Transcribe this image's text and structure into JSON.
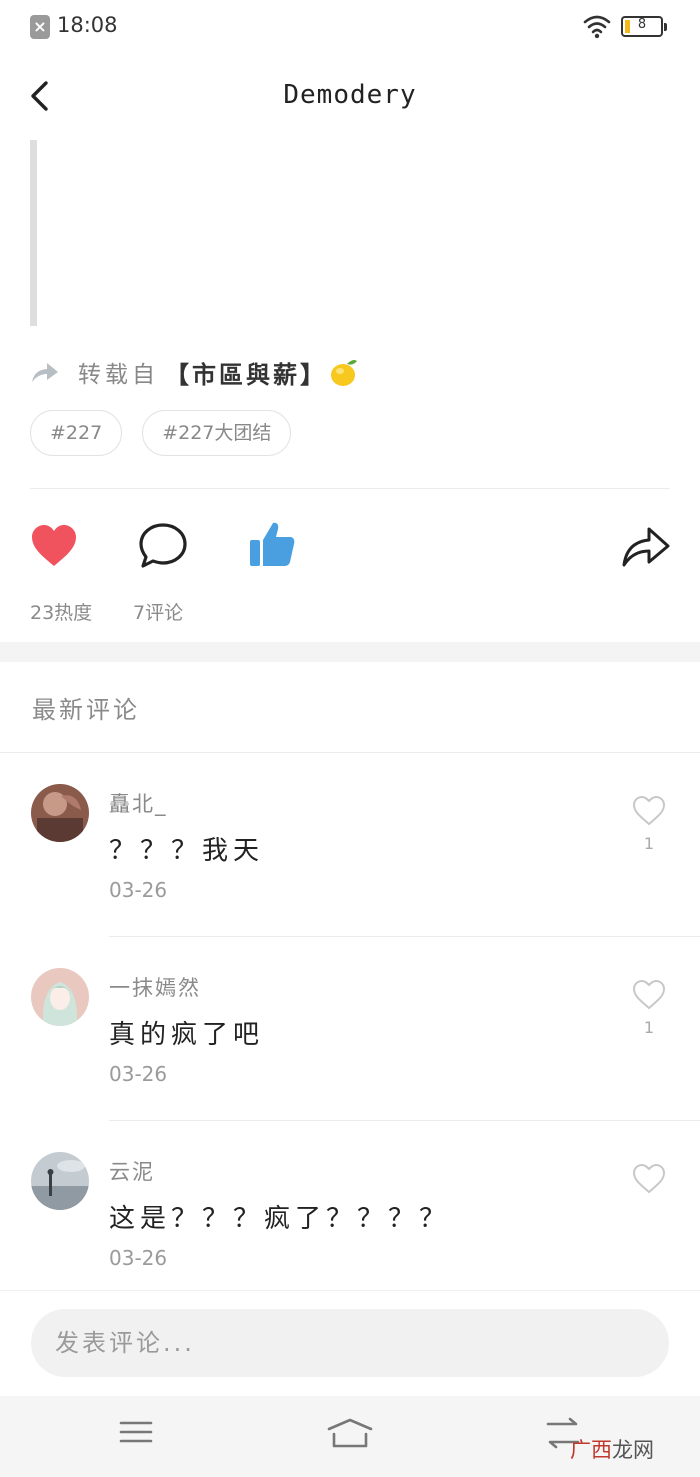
{
  "status_bar": {
    "time": "18:08",
    "battery": "8"
  },
  "header": {
    "title": "Demodery"
  },
  "post": {
    "repost_prefix": "转载自",
    "repost_source": "【市區與薪】",
    "tags": [
      "#227",
      "#227大团结"
    ],
    "heat_count": "23热度",
    "comment_count": "7评论"
  },
  "comments_section": {
    "title": "最新评论",
    "comments": [
      {
        "user": "矗北_",
        "text": "？？？我天",
        "date": "03-26",
        "likes": "1"
      },
      {
        "user": "一抹嫣然",
        "text": "真的疯了吧",
        "date": "03-26",
        "likes": "1"
      },
      {
        "user": "云泥",
        "text": "这是？？？疯了？？？？",
        "date": "03-26",
        "likes": ""
      }
    ]
  },
  "composer": {
    "placeholder": "发表评论..."
  },
  "watermark": {
    "brand_a": "广西",
    "brand_b": "龙网"
  },
  "colors": {
    "heart": "#f0525e",
    "like": "#4a9fe0",
    "text_muted": "#8a8a8a"
  },
  "icons": {
    "back": "chevron-left-icon",
    "repost": "repost-arrow-icon",
    "lemon": "lemon-emoji-icon",
    "heart": "heart-icon",
    "comment": "speech-bubble-icon",
    "like": "thumbs-up-icon",
    "share": "share-arrow-icon",
    "comment_like": "heart-outline-icon"
  }
}
